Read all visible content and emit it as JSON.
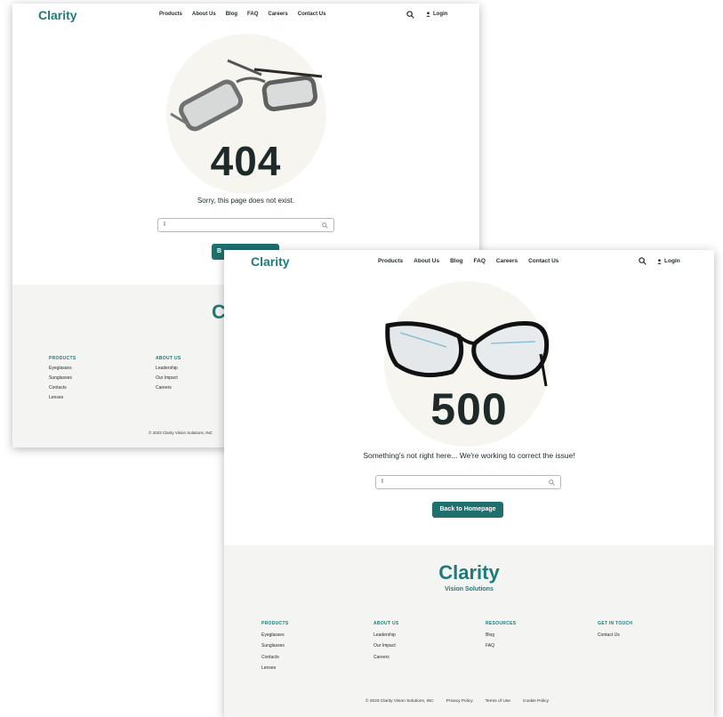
{
  "brand": {
    "name": "Clarity",
    "tagline": "Vision Solutions",
    "accent": "#1f7a78"
  },
  "nav": {
    "links": [
      "Products",
      "About Us",
      "Blog",
      "FAQ",
      "Careers",
      "Contact Us"
    ],
    "login_label": "Login",
    "icons": [
      "search-icon",
      "user-icon"
    ]
  },
  "page_404": {
    "code": "404",
    "message": "Sorry, this page does not exist.",
    "search_value": "I",
    "button_label": "B",
    "footer_logo": "C",
    "footer_columns": [
      {
        "heading": "PRODUCTS",
        "items": [
          "Eyeglasses",
          "Sunglasses",
          "Contacts",
          "Lenses"
        ]
      },
      {
        "heading": "ABOUT US",
        "items": [
          "Leadership",
          "Our Impact",
          "Careers"
        ]
      }
    ],
    "copyright": "© 2023 Clarity Vision Solutions, INC"
  },
  "page_500": {
    "code": "500",
    "message": "Something's not right here... We're working to correct the issue!",
    "search_value": "I",
    "button_label": "Back to Homepage",
    "footer_columns": [
      {
        "heading": "PRODUCTS",
        "items": [
          "Eyeglasses",
          "Sunglasses",
          "Contacts",
          "Lenses"
        ]
      },
      {
        "heading": "ABOUT US",
        "items": [
          "Leadership",
          "Our Impact",
          "Careers"
        ]
      },
      {
        "heading": "RESOURCES",
        "items": [
          "Blog",
          "FAQ"
        ]
      },
      {
        "heading": "GET IN TOUCH",
        "items": [
          "Contact Us"
        ]
      }
    ],
    "copyright": "© 2023 Clarity Vision Solutions, INC",
    "legal_links": [
      "Privacy Policy",
      "Terms of Use",
      "Cookie Policy"
    ]
  }
}
